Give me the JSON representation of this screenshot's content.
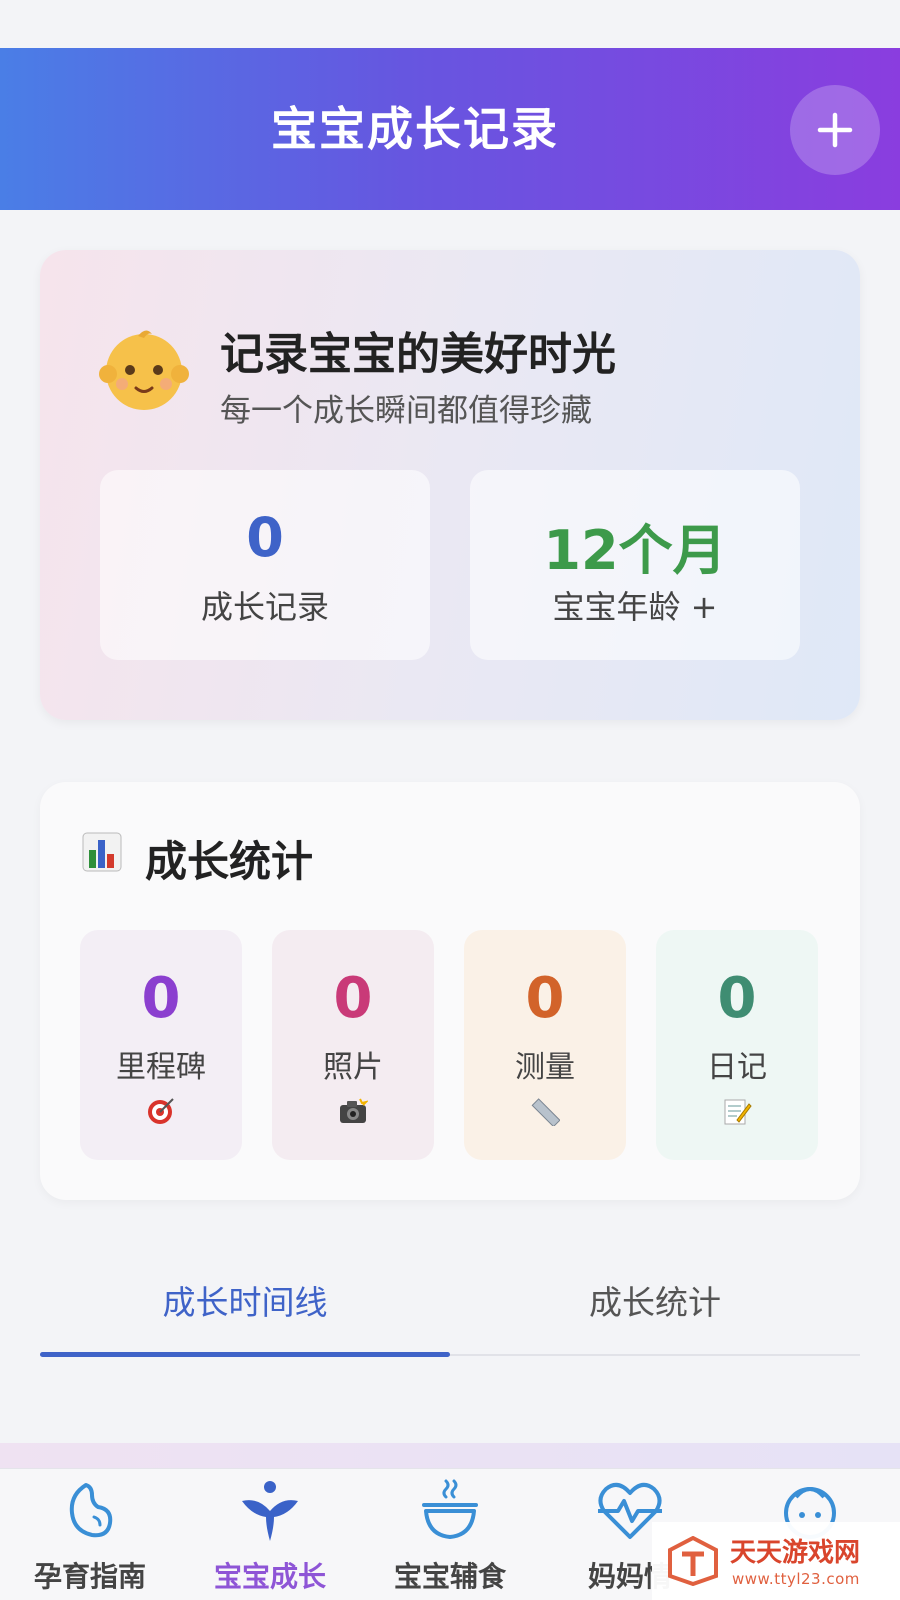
{
  "header": {
    "title": "宝宝成长记录",
    "add_icon": "plus-icon"
  },
  "hero": {
    "title": "记录宝宝的美好时光",
    "subtitle": "每一个成长瞬间都值得珍藏",
    "icon": "baby-face-icon",
    "stats": [
      {
        "value": "0",
        "label": "成长记录",
        "color": "#3f63c8"
      },
      {
        "value": "12个月",
        "label": "宝宝年龄 +",
        "color": "#3d9a4a"
      }
    ]
  },
  "growth_stats": {
    "title": "成长统计",
    "icon": "bar-chart-icon",
    "tiles": [
      {
        "value": "0",
        "label": "里程碑",
        "icon": "target-icon",
        "color": "#8b3fcf"
      },
      {
        "value": "0",
        "label": "照片",
        "icon": "camera-icon",
        "color": "#c93a78"
      },
      {
        "value": "0",
        "label": "测量",
        "icon": "ruler-icon",
        "color": "#d2632a"
      },
      {
        "value": "0",
        "label": "日记",
        "icon": "memo-icon",
        "color": "#3f8d72"
      }
    ]
  },
  "tabs": [
    {
      "label": "成长时间线",
      "active": true
    },
    {
      "label": "成长统计",
      "active": false
    }
  ],
  "bottom_nav": [
    {
      "label": "孕育指南",
      "icon": "pregnancy-icon",
      "active": false
    },
    {
      "label": "宝宝成长",
      "icon": "sprout-icon",
      "active": true
    },
    {
      "label": "宝宝辅食",
      "icon": "bowl-icon",
      "active": false
    },
    {
      "label": "妈妈情",
      "icon": "heart-pulse-icon",
      "active": false
    },
    {
      "label": "",
      "icon": "baby-head-icon",
      "active": false
    }
  ],
  "watermark": {
    "name": "天天游戏网",
    "url": "www.ttyl23.com"
  },
  "colors": {
    "accent": "#3f63c8",
    "header_gradient": [
      "#4a7ee6",
      "#8a3ddf"
    ],
    "nav_active": "#8e55d6"
  }
}
